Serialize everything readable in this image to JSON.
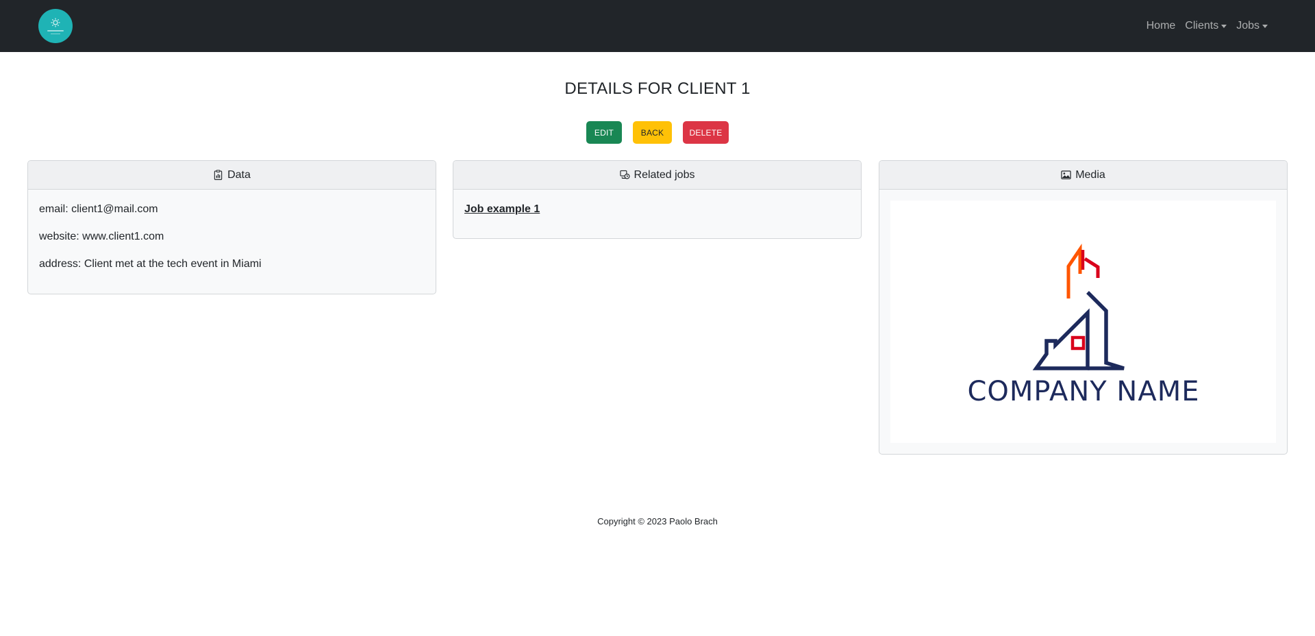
{
  "navbar": {
    "links": [
      {
        "label": "Home"
      },
      {
        "label": "Clients"
      },
      {
        "label": "Jobs"
      }
    ]
  },
  "page": {
    "title": "DETAILS FOR CLIENT 1"
  },
  "actions": {
    "edit_label": "EDIT",
    "back_label": "BACK",
    "delete_label": "DELETE"
  },
  "cards": {
    "data": {
      "title": "Data",
      "icon": "clipboard-data-icon",
      "email": "email: client1@mail.com",
      "website": "website: www.client1.com",
      "address": "address: Client met at the tech event in Miami"
    },
    "related_jobs": {
      "title": "Related jobs",
      "icon": "jobs-stack-icon",
      "jobs": [
        "Job example 1"
      ]
    },
    "media": {
      "title": "Media",
      "icon": "image-icon",
      "logo_text": "COMPANY NAME",
      "colors": {
        "navy": "#1d2a5c",
        "orange": "#ff5500",
        "red": "#d9001b"
      }
    }
  },
  "footer": {
    "copyright": "Copyright © 2023 Paolo Brach"
  },
  "theme": {
    "navbar_bg": "#212529",
    "success": "#198754",
    "warning": "#ffc107",
    "danger": "#dc3545",
    "brand_teal": "#1fb3b5"
  }
}
